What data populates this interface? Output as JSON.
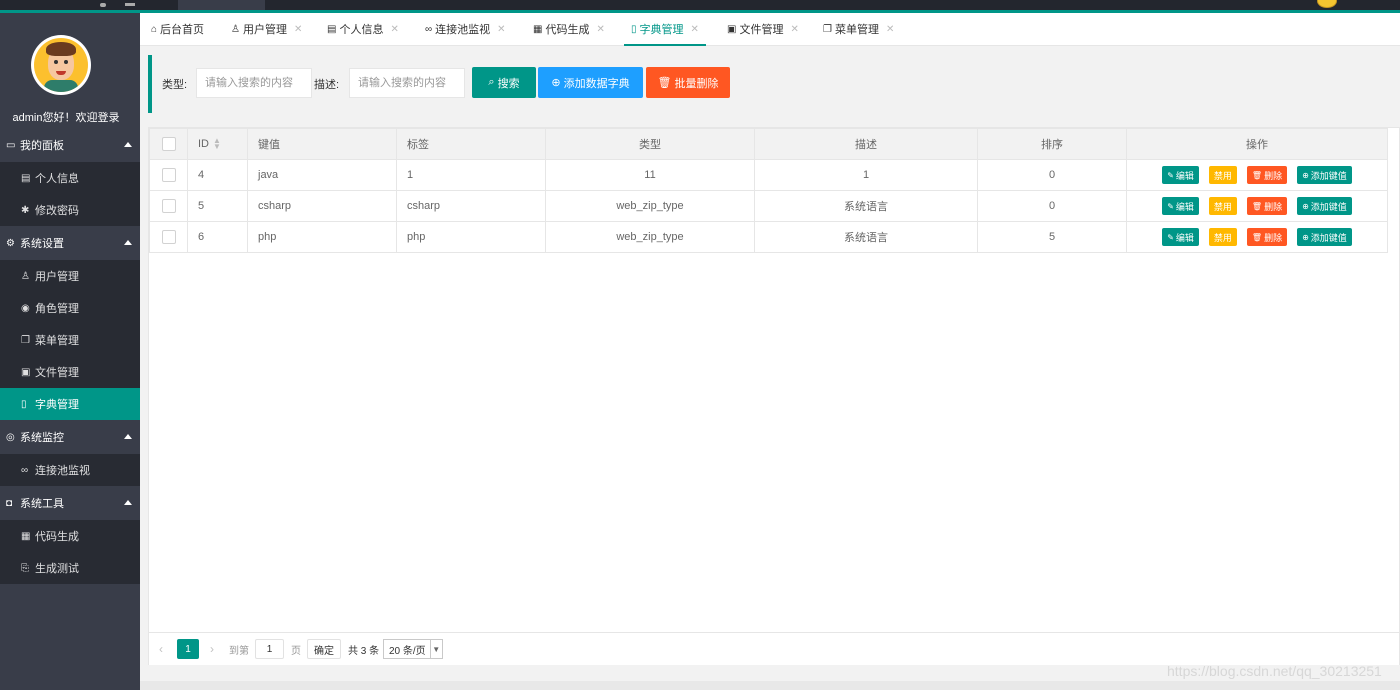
{
  "colors": {
    "accent": "#009688",
    "sidebar": "#393d49",
    "blue": "#1e9fff",
    "red": "#ff5722",
    "yellow": "#ffb800"
  },
  "sidebar": {
    "welcome": "admin您好！欢迎登录",
    "groups": [
      {
        "label": "我的面板",
        "icon": "monitor-icon",
        "items": [
          {
            "label": "个人信息",
            "icon": "id-card-icon"
          },
          {
            "label": "修改密码",
            "icon": "gear-icon"
          }
        ]
      },
      {
        "label": "系统设置",
        "icon": "gears-icon",
        "items": [
          {
            "label": "用户管理",
            "icon": "user-icon"
          },
          {
            "label": "角色管理",
            "icon": "user-circle-icon"
          },
          {
            "label": "菜单管理",
            "icon": "windows-icon"
          },
          {
            "label": "文件管理",
            "icon": "file-image-icon"
          },
          {
            "label": "字典管理",
            "icon": "file-icon",
            "active": true
          }
        ]
      },
      {
        "label": "系统监控",
        "icon": "eye-icon",
        "items": [
          {
            "label": "连接池监视",
            "icon": "link-icon"
          }
        ]
      },
      {
        "label": "系统工具",
        "icon": "tools-icon",
        "items": [
          {
            "label": "代码生成",
            "icon": "code-icon"
          },
          {
            "label": "生成测试",
            "icon": "copy-icon"
          }
        ]
      }
    ]
  },
  "tabs": [
    {
      "label": "后台首页",
      "icon": "home-icon"
    },
    {
      "label": "用户管理",
      "icon": "user-icon"
    },
    {
      "label": "个人信息",
      "icon": "id-card-icon"
    },
    {
      "label": "连接池监视",
      "icon": "link-icon"
    },
    {
      "label": "代码生成",
      "icon": "code-icon"
    },
    {
      "label": "字典管理",
      "icon": "file-icon",
      "active": true
    },
    {
      "label": "文件管理",
      "icon": "file-image-icon"
    },
    {
      "label": "菜单管理",
      "icon": "windows-icon"
    }
  ],
  "search": {
    "type_label": "类型:",
    "type_placeholder": "请输入搜索的内容",
    "desc_label": "描述:",
    "desc_placeholder": "请输入搜索的内容",
    "search_button": "搜索",
    "add_button": "添加数据字典",
    "batch_delete_button": "批量删除"
  },
  "table": {
    "headers": {
      "id": "ID",
      "key": "键值",
      "label": "标签",
      "type": "类型",
      "desc": "描述",
      "sort": "排序",
      "ops": "操作"
    },
    "rows": [
      {
        "id": "4",
        "key": "java",
        "label": "1",
        "type": "11",
        "desc": "1",
        "sort": "0"
      },
      {
        "id": "5",
        "key": "csharp",
        "label": "csharp",
        "type": "web_zip_type",
        "desc": "系统语言",
        "sort": "0"
      },
      {
        "id": "6",
        "key": "php",
        "label": "php",
        "type": "web_zip_type",
        "desc": "系统语言",
        "sort": "5"
      }
    ],
    "actions": {
      "edit": "编辑",
      "ban": "禁用",
      "delete": "删除",
      "add_key": "添加键值"
    }
  },
  "pager": {
    "current": "1",
    "goto_label": "到第",
    "goto_value": "1",
    "page_label": "页",
    "confirm": "确定",
    "total": "共 3 条",
    "page_size": "20 条/页"
  },
  "watermark": "https://blog.csdn.net/qq_30213251"
}
